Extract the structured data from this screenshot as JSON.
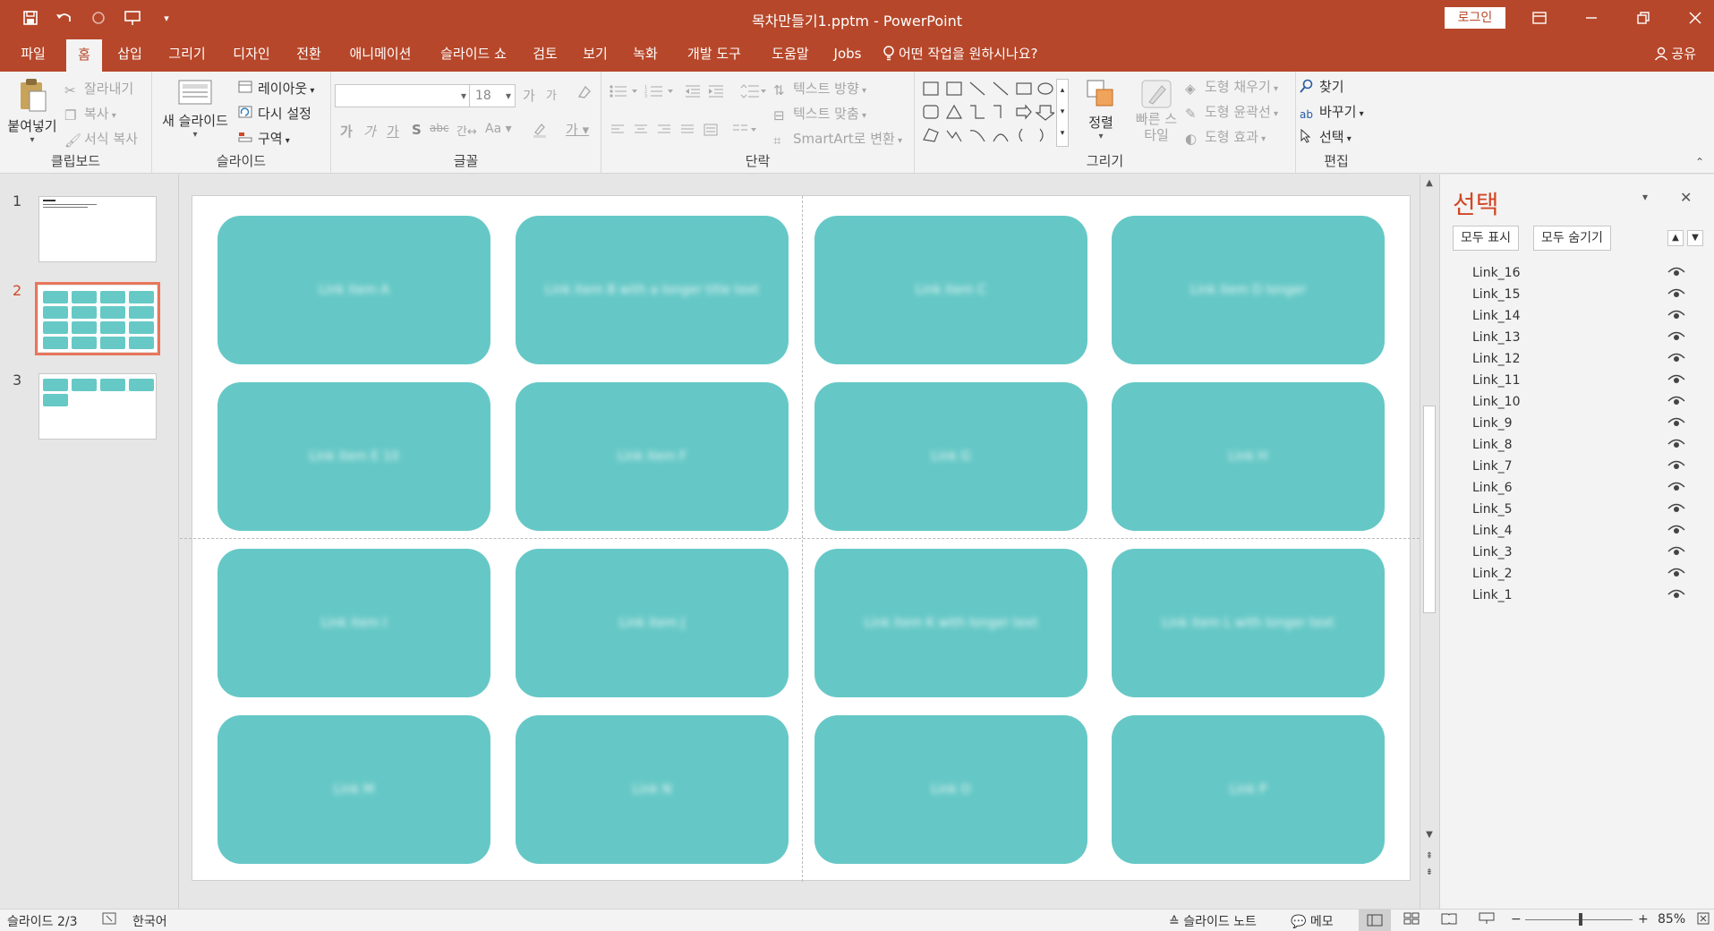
{
  "window": {
    "title": "목차만들기1.pptm  -  PowerPoint",
    "login_label": "로그인"
  },
  "tabs": [
    {
      "label": "파일"
    },
    {
      "label": "홈"
    },
    {
      "label": "삽입"
    },
    {
      "label": "그리기"
    },
    {
      "label": "디자인"
    },
    {
      "label": "전환"
    },
    {
      "label": "애니메이션"
    },
    {
      "label": "슬라이드 쇼"
    },
    {
      "label": "검토"
    },
    {
      "label": "보기"
    },
    {
      "label": "녹화"
    },
    {
      "label": "개발 도구"
    },
    {
      "label": "도움말"
    },
    {
      "label": "Jobs"
    },
    {
      "label": "어떤 작업을 원하시나요?"
    }
  ],
  "share_label": "공유",
  "ribbon": {
    "clipboard": {
      "group": "클립보드",
      "paste": "붙여넣기",
      "cut": "잘라내기",
      "copy": "복사",
      "format_painter": "서식 복사"
    },
    "slides": {
      "group": "슬라이드",
      "new_slide": "새 슬라이드",
      "layout": "레이아웃",
      "reset": "다시 설정",
      "section": "구역"
    },
    "font": {
      "group": "글꼴",
      "font_name": "",
      "font_size": "18"
    },
    "paragraph": {
      "group": "단락",
      "text_direction": "텍스트 방향",
      "align_text": "텍스트 맞춤",
      "smartart": "SmartArt로 변환"
    },
    "drawing": {
      "group": "그리기",
      "arrange": "정렬",
      "quick_styles": "빠른 스타일",
      "fill": "도형 채우기",
      "outline": "도형 윤곽선",
      "effects": "도형 효과"
    },
    "editing": {
      "group": "편집",
      "find": "찾기",
      "replace": "바꾸기",
      "select": "선택"
    }
  },
  "thumbnails": [
    {
      "number": "1"
    },
    {
      "number": "2"
    },
    {
      "number": "3"
    }
  ],
  "slide_cards": [
    {
      "text": "Link item A"
    },
    {
      "text": "Link item B with a longer title text"
    },
    {
      "text": "Link item C"
    },
    {
      "text": "Link item D longer"
    },
    {
      "text": "Link item E 10"
    },
    {
      "text": "Link item F"
    },
    {
      "text": "Link G"
    },
    {
      "text": "Link H"
    },
    {
      "text": "Link item I"
    },
    {
      "text": "Link item J"
    },
    {
      "text": "Link item K with longer text"
    },
    {
      "text": "Link item L with longer text"
    },
    {
      "text": "Link M"
    },
    {
      "text": "Link N"
    },
    {
      "text": "Link O"
    },
    {
      "text": "Link P"
    }
  ],
  "selection_pane": {
    "title": "선택",
    "show_all": "모두 표시",
    "hide_all": "모두 숨기기",
    "items": [
      {
        "name": "Link_16"
      },
      {
        "name": "Link_15"
      },
      {
        "name": "Link_14"
      },
      {
        "name": "Link_13"
      },
      {
        "name": "Link_12"
      },
      {
        "name": "Link_11"
      },
      {
        "name": "Link_10"
      },
      {
        "name": "Link_9"
      },
      {
        "name": "Link_8"
      },
      {
        "name": "Link_7"
      },
      {
        "name": "Link_6"
      },
      {
        "name": "Link_5"
      },
      {
        "name": "Link_4"
      },
      {
        "name": "Link_3"
      },
      {
        "name": "Link_2"
      },
      {
        "name": "Link_1"
      }
    ]
  },
  "status": {
    "slide_position": "슬라이드 2/3",
    "language": "한국어",
    "notes": "슬라이드 노트",
    "comments": "메모",
    "zoom": "85%"
  },
  "colors": {
    "accent": "#b7472a",
    "card": "#66c8c6",
    "selection_title": "#d24726"
  }
}
